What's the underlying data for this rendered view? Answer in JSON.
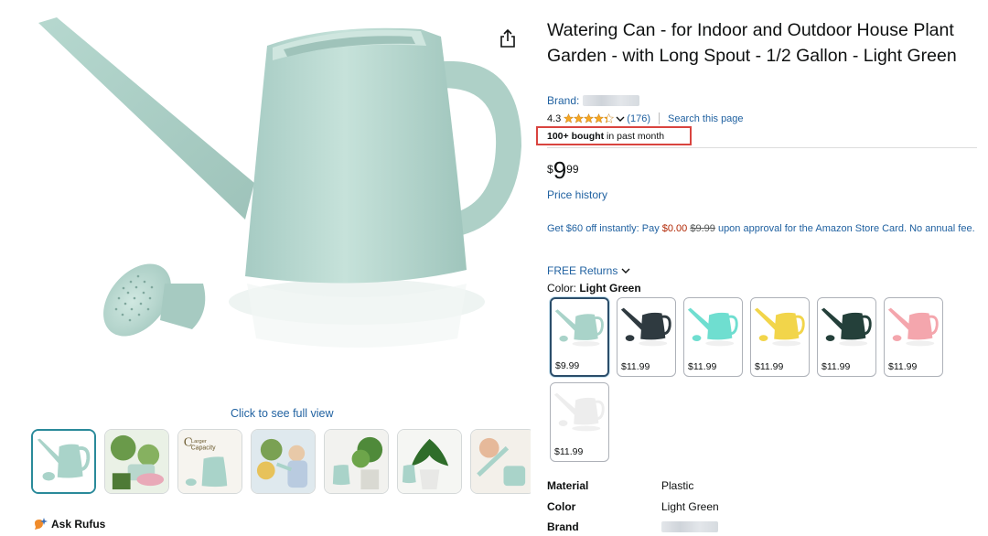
{
  "gallery": {
    "full_view_label": "Click to see full view",
    "ask_rufus_label": "Ask Rufus",
    "thumbnails": [
      {
        "name": "thumb-main",
        "selected": true
      },
      {
        "name": "thumb-plants"
      },
      {
        "name": "thumb-capacity",
        "text": "Capacity"
      },
      {
        "name": "thumb-child"
      },
      {
        "name": "thumb-plant-shelf"
      },
      {
        "name": "thumb-pot-plant"
      },
      {
        "name": "thumb-spout"
      }
    ]
  },
  "product": {
    "title": "Watering Can - for Indoor and Outdoor House Plant Garden - with Long Spout - 1/2 Gallon - Light Green",
    "brand_label": "Brand:",
    "rating": "4.3",
    "rating_count": "(176)",
    "search_page_label": "Search this page",
    "bought_bold": "100+ bought",
    "bought_rest": " in past month",
    "price_symbol": "$",
    "price_whole": "9",
    "price_fraction": "99",
    "price_history_label": "Price history",
    "promo_part1": "Get $60 off instantly: Pay ",
    "promo_price": "$0.00",
    "promo_strike": "$9.99",
    "promo_part2": " upon approval for the Amazon Store Card. No annual fee.",
    "free_returns_label": "FREE Returns",
    "color_prefix": "Color: ",
    "color_selected": "Light Green"
  },
  "swatches": [
    {
      "price": "$9.99",
      "color": "#a9d3c9",
      "name": "light-green",
      "selected": true
    },
    {
      "price": "$11.99",
      "color": "#2f3a40",
      "name": "dark-gray"
    },
    {
      "price": "$11.99",
      "color": "#6fded0",
      "name": "turquoise"
    },
    {
      "price": "$11.99",
      "color": "#f2d54a",
      "name": "yellow"
    },
    {
      "price": "$11.99",
      "color": "#24403a",
      "name": "dark-green"
    },
    {
      "price": "$11.99",
      "color": "#f4a6ad",
      "name": "pink"
    },
    {
      "price": "$11.99",
      "color": "#ededed",
      "name": "white"
    }
  ],
  "specs": [
    {
      "key": "Material",
      "value": "Plastic"
    },
    {
      "key": "Color",
      "value": "Light Green"
    },
    {
      "key": "Brand",
      "value": ""
    }
  ],
  "colors": {
    "link": "#2162a1",
    "highlight_box": "#d9443f",
    "product_mint": "#b7d9d1",
    "rufus_orange": "#f08b2a"
  }
}
